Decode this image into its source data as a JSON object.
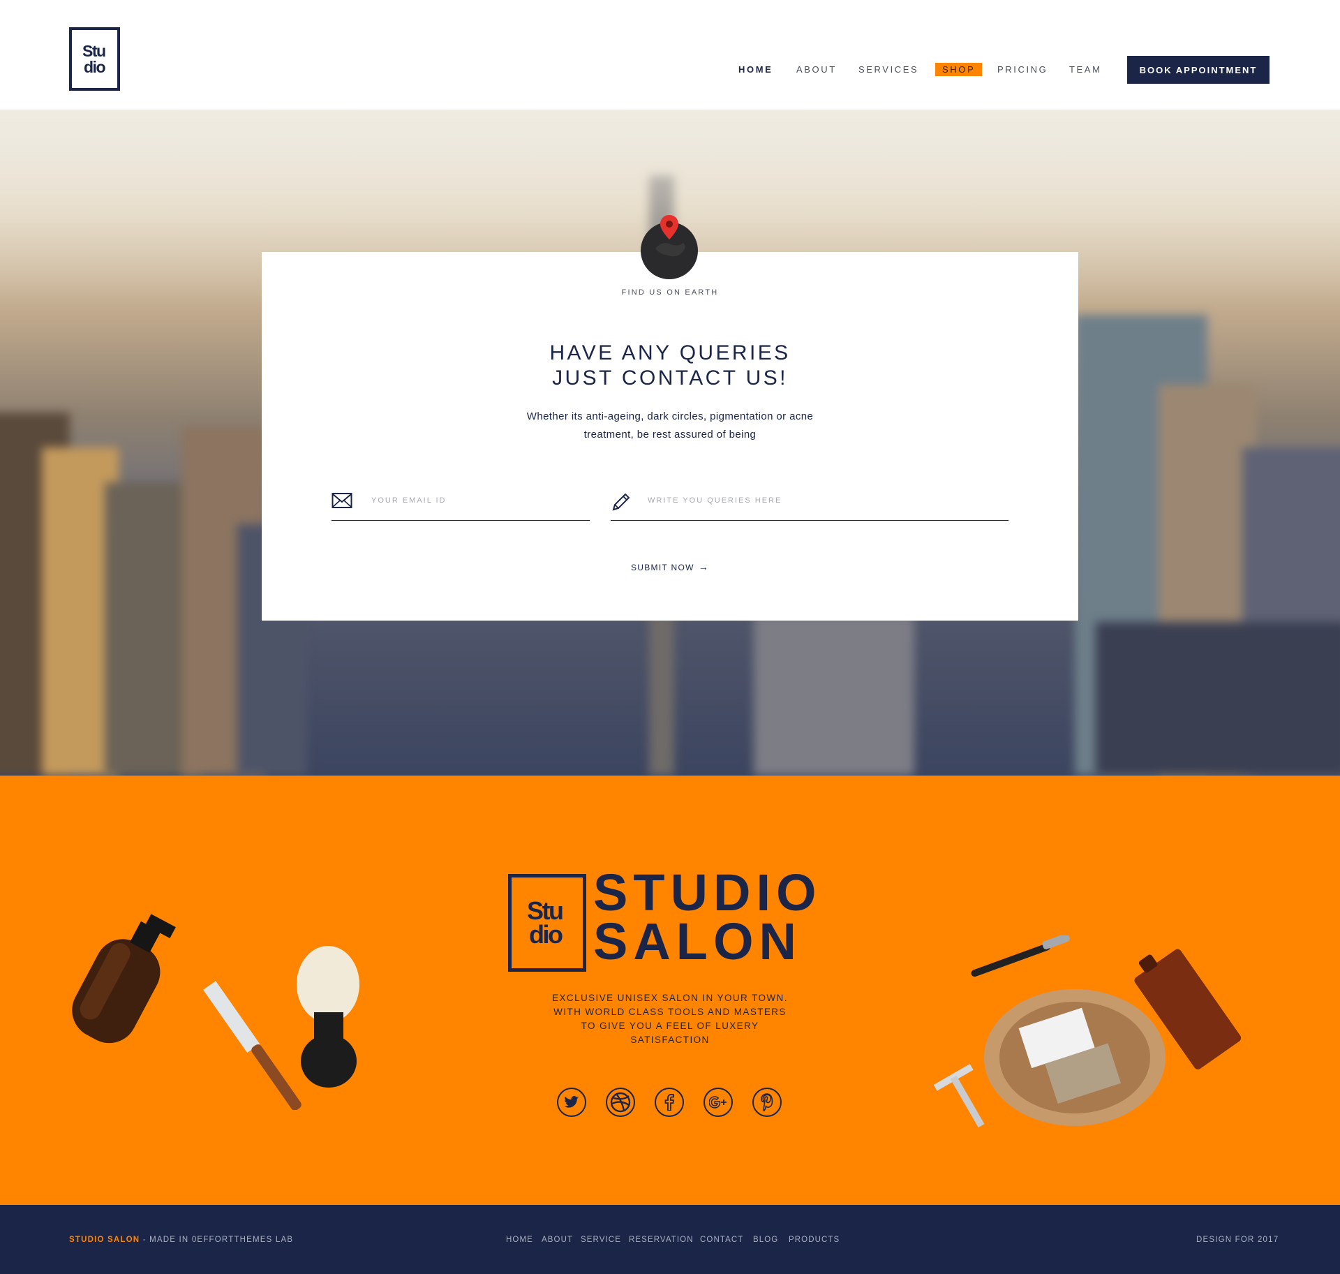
{
  "header": {
    "logo_line1": "Stu",
    "logo_line2": "dio",
    "nav": [
      {
        "label": "HOME",
        "active": true
      },
      {
        "label": "ABOUT"
      },
      {
        "label": "SERVICES"
      },
      {
        "label": "SHOP",
        "highlight": true
      },
      {
        "label": "PRICING"
      },
      {
        "label": "TEAM"
      }
    ],
    "book_button": "BOOK APPOINTMENT"
  },
  "contact": {
    "find_label": "FIND US ON EARTH",
    "headline_line1": "HAVE ANY QUERIES",
    "headline_line2": "JUST CONTACT US!",
    "description_line1": "Whether its anti-ageing, dark circles, pigmentation or acne",
    "description_line2": "treatment, be rest assured of being",
    "email_placeholder": "YOUR EMAIL ID",
    "query_placeholder": "WRITE YOU QUERIES HERE",
    "submit_label": "SUBMIT NOW"
  },
  "brand": {
    "logo_line1": "Stu",
    "logo_line2": "dio",
    "name_line1": "STUDIO",
    "name_line2": "SALON",
    "tagline_line1": "EXCLUSIVE UNISEX SALON IN YOUR TOWN.",
    "tagline_line2": "WITH WORLD CLASS TOOLS AND MASTERS",
    "tagline_line3": "TO GIVE YOU A FEEL OF LUXERY",
    "tagline_line4": "SATISFACTION",
    "socials": [
      "twitter-icon",
      "dribbble-icon",
      "facebook-icon",
      "google-plus-icon",
      "pinterest-icon"
    ]
  },
  "footer": {
    "brand": "STUDIO SALON",
    "made_in": " - MADE IN 0EFFORTTHEMES LAB",
    "nav": [
      "HOME",
      "ABOUT",
      "SERVICE",
      "RESERVATION",
      "CONTACT",
      "BLOG",
      "PRODUCTS"
    ],
    "right": "DESIGN FOR 2017"
  },
  "colors": {
    "navy": "#1b2547",
    "orange": "#ff8400",
    "pin_red": "#e5322d"
  }
}
